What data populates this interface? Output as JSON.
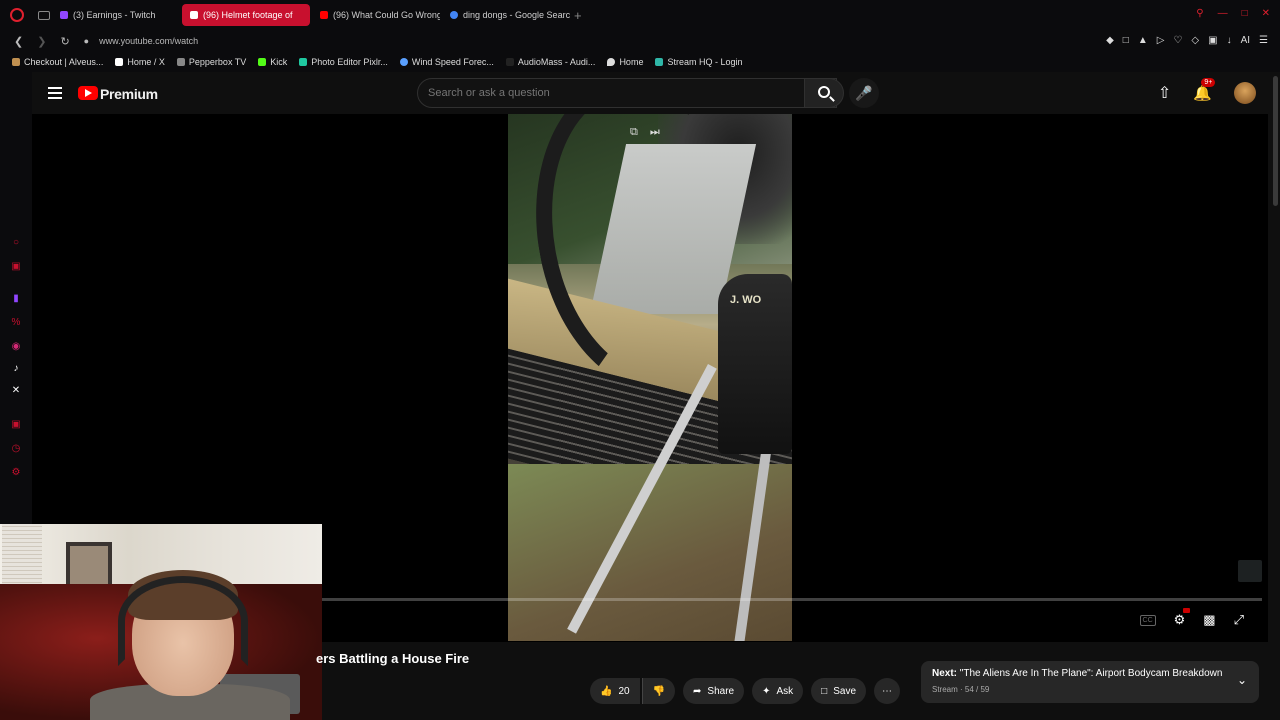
{
  "browser": {
    "tabs": [
      {
        "label": "(3) Earnings - Twitch",
        "color": "#9146ff"
      },
      {
        "label": "(96) Helmet footage of",
        "color": "#ff0000",
        "active": true
      },
      {
        "label": "(96) What Could Go Wrong",
        "color": "#ff0000"
      },
      {
        "label": "ding dongs - Google Search",
        "color": "#4285f4"
      }
    ],
    "new_tab": "+",
    "url": "www.youtube.com/watch",
    "bookmarks": [
      {
        "label": "Checkout | Alveus...",
        "color": "#c09050"
      },
      {
        "label": "Home / X",
        "color": "#ffffff"
      },
      {
        "label": "Pepperbox TV",
        "color": "#888888"
      },
      {
        "label": "Kick",
        "color": "#53fc18"
      },
      {
        "label": "Photo Editor Pixlr...",
        "color": "#1fc8a0"
      },
      {
        "label": "Wind Speed Forec...",
        "color": "#5aa0ff"
      },
      {
        "label": "AudioMass - Audi...",
        "color": "#222222"
      },
      {
        "label": "Home",
        "color": "#dddddd"
      },
      {
        "label": "Stream HQ - Login",
        "color": "#2fb7a8"
      }
    ],
    "accent": "#c8102e"
  },
  "youtube": {
    "brand": "Premium",
    "search_placeholder": "Search or ask a question",
    "notification_count": "9+",
    "video_overlay_text": "J. WO",
    "title": "ers Battling a House Fire",
    "like_count": "20",
    "actions": {
      "share": "Share",
      "ask": "Ask",
      "save": "Save"
    },
    "next": {
      "prefix": "Next:",
      "title": "\"The Aliens Are In The Plane\": Airport Bodycam Breakdown",
      "sub": "Stream · 54 / 59"
    },
    "cc_label": "CC"
  }
}
